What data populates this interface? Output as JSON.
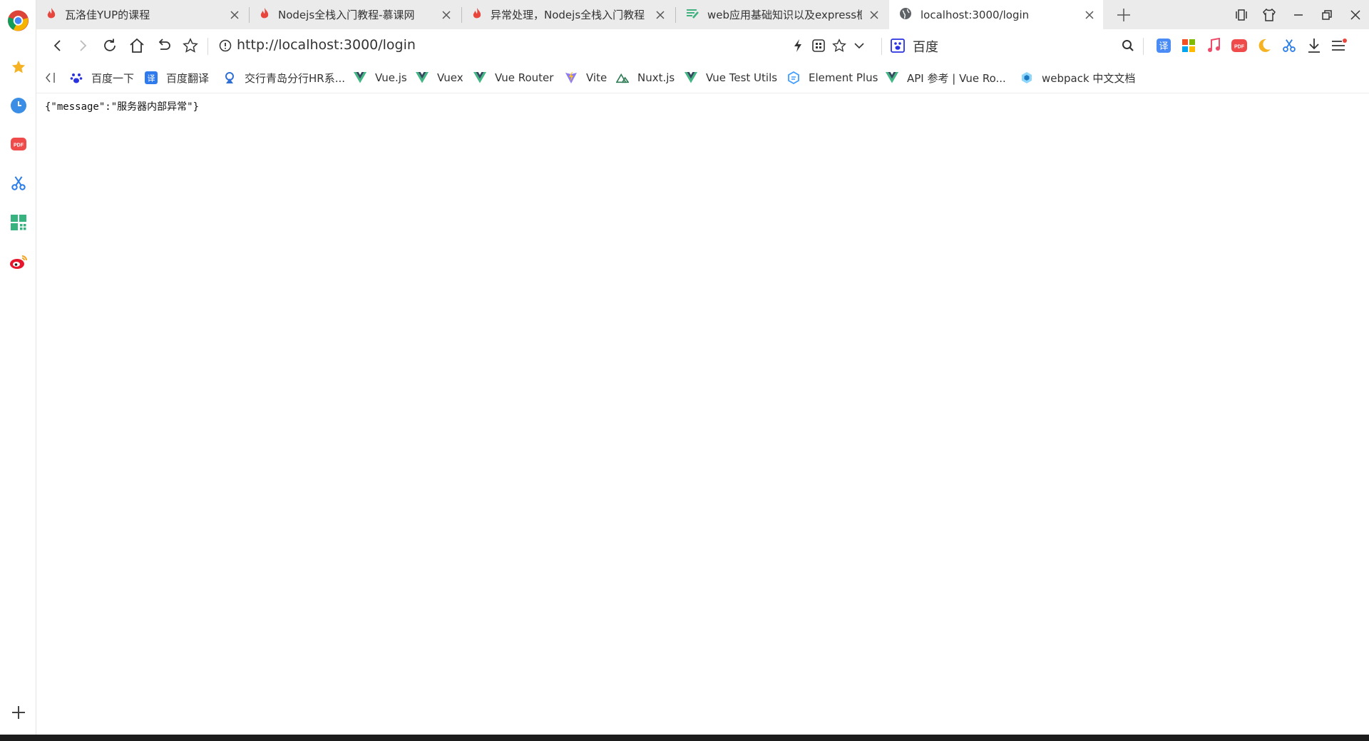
{
  "tabs": [
    {
      "title": "瓦洛佳YUP的课程",
      "icon": "fire-icon",
      "active": false
    },
    {
      "title": "Nodejs全栈入门教程-慕课网",
      "icon": "fire-icon",
      "active": false
    },
    {
      "title": "异常处理，Nodejs全栈入门教程",
      "icon": "fire-icon",
      "active": false
    },
    {
      "title": "web应用基础知识以及express框",
      "icon": "doc-icon",
      "active": false
    },
    {
      "title": "localhost:3000/login",
      "icon": "globe-icon",
      "active": true
    }
  ],
  "address_bar": {
    "url": "http://localhost:3000/login"
  },
  "search_engine": {
    "label": "百度"
  },
  "bookmarks": [
    {
      "label": "百度一下",
      "icon": "baidu-paw-icon"
    },
    {
      "label": "百度翻译",
      "icon": "translate-icon"
    },
    {
      "label": "交行青岛分行HR系...",
      "icon": "bank-icon"
    },
    {
      "label": "Vue.js",
      "icon": "vue-icon"
    },
    {
      "label": "Vuex",
      "icon": "vue-icon"
    },
    {
      "label": "Vue Router",
      "icon": "vue-icon"
    },
    {
      "label": "Vite",
      "icon": "vite-icon"
    },
    {
      "label": "Nuxt.js",
      "icon": "nuxt-icon"
    },
    {
      "label": "Vue Test Utils",
      "icon": "vue-icon"
    },
    {
      "label": "Element Plus",
      "icon": "element-icon"
    },
    {
      "label": "API 参考 | Vue Ro...",
      "icon": "vue-icon"
    },
    {
      "label": "webpack 中文文档",
      "icon": "webpack-icon"
    }
  ],
  "page": {
    "body_text": "{\"message\":\"服务器内部异常\"}"
  },
  "colors": {
    "vue_green": "#41b883",
    "vue_dark": "#35495e",
    "fire_red": "#e8453c",
    "active_tab": "#ffffff",
    "tab_strip": "#ebebeb"
  }
}
